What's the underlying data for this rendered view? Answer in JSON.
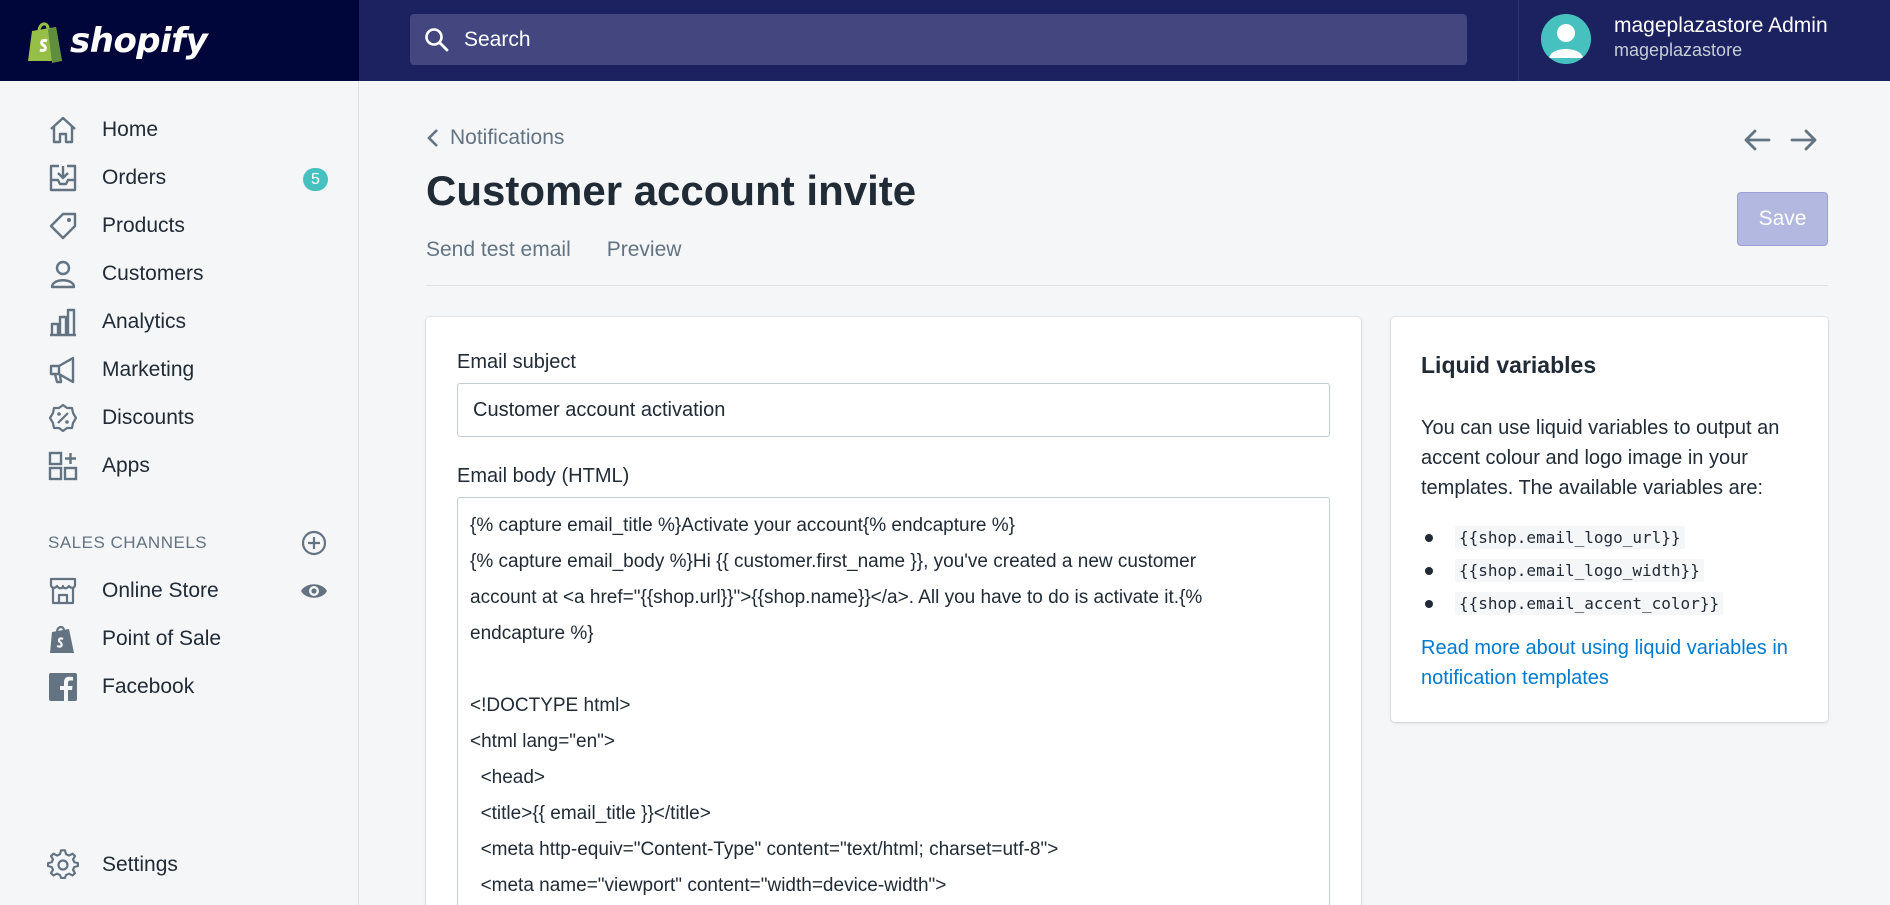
{
  "topbar": {
    "brand": "shopify",
    "search_placeholder": "Search",
    "user_name": "mageplazastore Admin",
    "user_store": "mageplazastore"
  },
  "sidebar": {
    "items": [
      {
        "label": "Home",
        "icon": "home-icon"
      },
      {
        "label": "Orders",
        "icon": "orders-icon",
        "badge": "5"
      },
      {
        "label": "Products",
        "icon": "tag-icon"
      },
      {
        "label": "Customers",
        "icon": "person-icon"
      },
      {
        "label": "Analytics",
        "icon": "bar-chart-icon"
      },
      {
        "label": "Marketing",
        "icon": "megaphone-icon"
      },
      {
        "label": "Discounts",
        "icon": "discount-icon"
      },
      {
        "label": "Apps",
        "icon": "apps-icon"
      }
    ],
    "sales_channels_heading": "SALES CHANNELS",
    "channels": [
      {
        "label": "Online Store",
        "icon": "store-icon"
      },
      {
        "label": "Point of Sale",
        "icon": "shopify-bag-icon"
      },
      {
        "label": "Facebook",
        "icon": "facebook-icon"
      }
    ],
    "settings_label": "Settings"
  },
  "page": {
    "breadcrumb": "Notifications",
    "title": "Customer account invite",
    "actions": [
      "Send test email",
      "Preview"
    ],
    "save_label": "Save"
  },
  "email": {
    "subject_label": "Email subject",
    "subject_value": "Customer account activation",
    "body_label": "Email body (HTML)",
    "body_value": "{% capture email_title %}Activate your account{% endcapture %}\n{% capture email_body %}Hi {{ customer.first_name }}, you've created a new customer\naccount at <a href=\"{{shop.url}}\">{{shop.name}}</a>. All you have to do is activate it.{%\nendcapture %}\n\n<!DOCTYPE html>\n<html lang=\"en\">\n  <head>\n  <title>{{ email_title }}</title>\n  <meta http-equiv=\"Content-Type\" content=\"text/html; charset=utf-8\">\n  <meta name=\"viewport\" content=\"width=device-width\">"
  },
  "liquid": {
    "title": "Liquid variables",
    "description": "You can use liquid variables to output an accent colour and logo image in your templates. The available variables are:",
    "variables": [
      "{{shop.email_logo_url}}",
      "{{shop.email_logo_width}}",
      "{{shop.email_accent_color}}"
    ],
    "link": "Read more about using liquid variables in notification templates"
  },
  "colors": {
    "topbar": "#1c2260",
    "brand_bg": "#000639",
    "accent_teal": "#47c1bf",
    "link_blue": "#007ace",
    "save_disabled": "#b3b8e0"
  }
}
